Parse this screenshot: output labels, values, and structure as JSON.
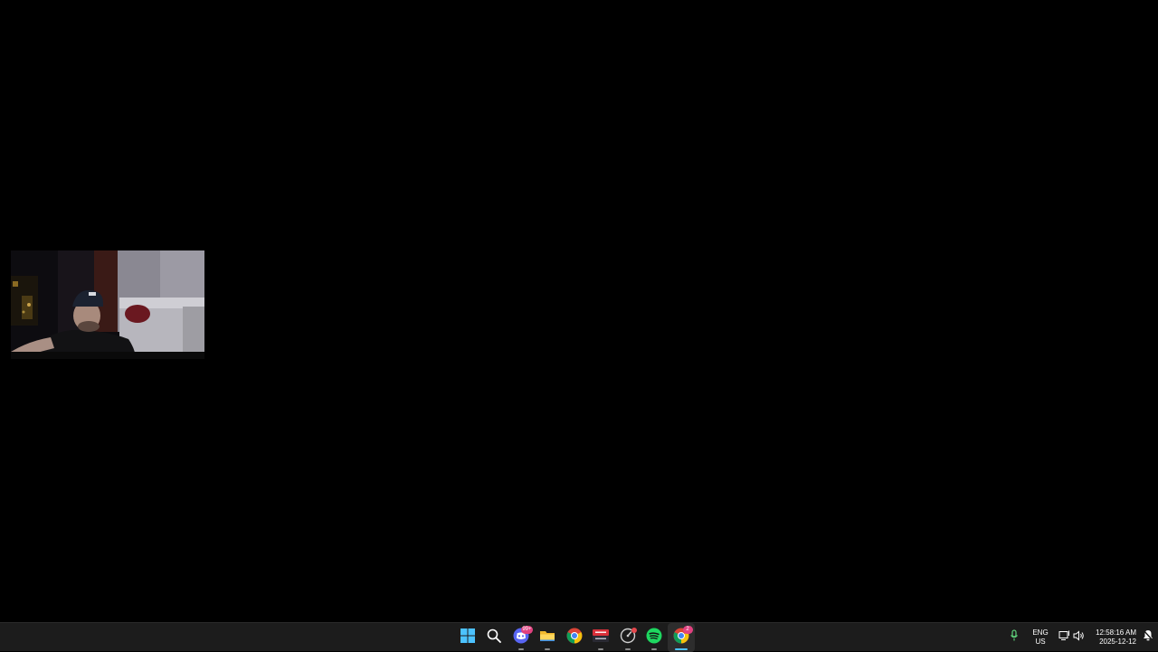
{
  "desktop": {
    "background_color": "#000000"
  },
  "webcam": {
    "icon": "webcam-feed-image"
  },
  "taskbar": {
    "background_color": "#1c1c1c",
    "apps": [
      {
        "name": "Start",
        "icon": "windows-start-icon"
      },
      {
        "name": "Search",
        "icon": "search-icon"
      },
      {
        "name": "Discord",
        "icon": "discord-icon",
        "badge": "99+"
      },
      {
        "name": "File Explorer",
        "icon": "folder-icon"
      },
      {
        "name": "Google Chrome",
        "icon": "chrome-icon"
      },
      {
        "name": "Video app",
        "icon": "video-app-icon"
      },
      {
        "name": "Performance app",
        "icon": "gauge-icon"
      },
      {
        "name": "Spotify",
        "icon": "spotify-icon"
      },
      {
        "name": "Google Chrome (active)",
        "icon": "chrome-icon",
        "badge": "2"
      }
    ],
    "tray": {
      "language_line1": "ENG",
      "language_line2": "US",
      "time": "12:58:16 AM",
      "date": "2025-12-12"
    }
  }
}
